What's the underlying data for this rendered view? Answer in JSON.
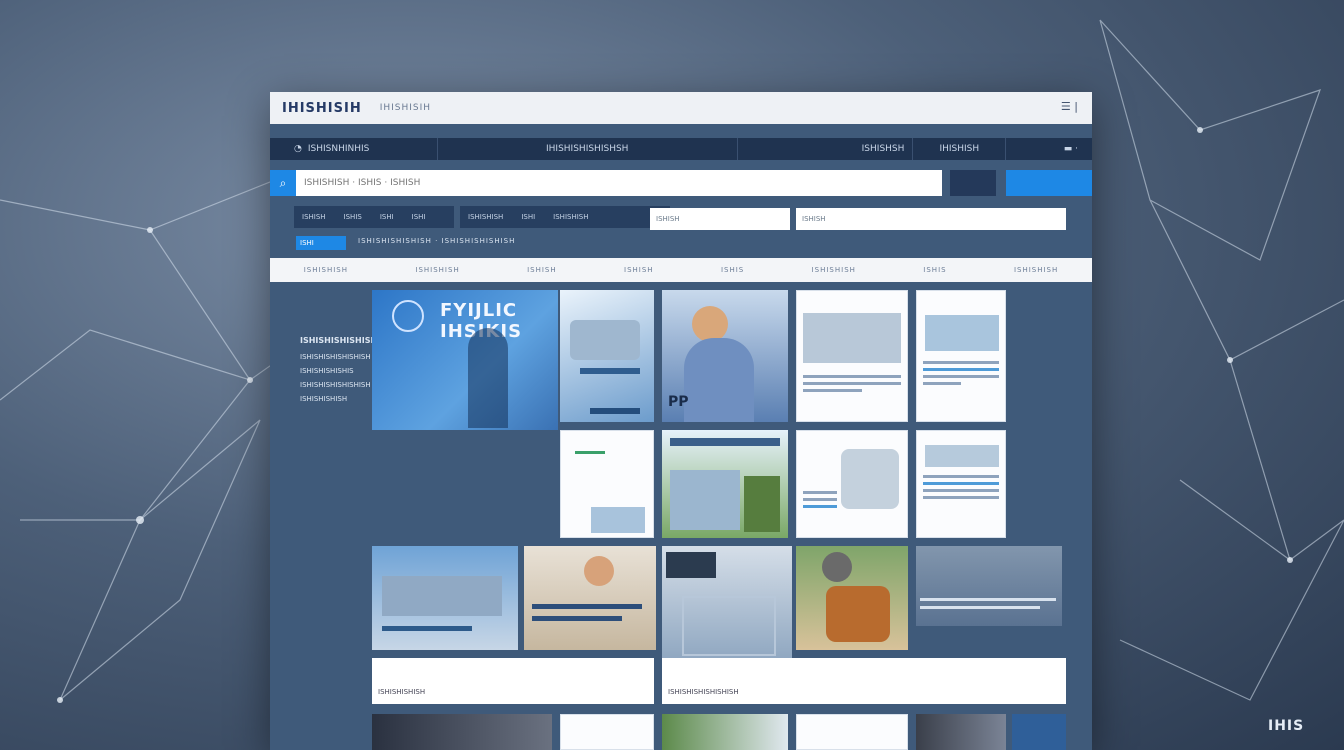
{
  "app": {
    "title": "IHISHISIH",
    "subtitle": "IHISHISIH",
    "menu_icon": "menu-icon"
  },
  "topnav": {
    "brand_icon": "logo-icon",
    "items": [
      "ISHISNHINHIS",
      "IHISHISHISHISHSH",
      "ISHISHSH",
      "IHISHISH"
    ],
    "account": "▬ ·"
  },
  "search": {
    "placeholder": "ISHISHISH · ISHIS · ISHISH",
    "icon": "search-icon",
    "button_label": ""
  },
  "filters": {
    "chips": [
      "ISHISH",
      "ISHIS",
      "ISHI",
      "ISHI",
      "ISHISHISH",
      "ISHI",
      "ISHISHISH"
    ],
    "field1": "ISHISH",
    "field2": "ISHISH"
  },
  "tag": "ISHI",
  "meta": "ISHISHISHISHISH · ISHISHISHISHISH",
  "tabs": [
    "ISHISHISH",
    "ISHISHISH",
    "ISHISH",
    "ISHISH",
    "ISHIS",
    "ISHISHISH",
    "ISHIS",
    "ISHISHISH"
  ],
  "sidebar": {
    "heading": "ISHISHISHISHISH",
    "lines": [
      "ISHISHISHISHISHISH",
      "ISHISHISHISHIS",
      "ISHISHISHISHISHISH",
      "ISHISHISHISH"
    ]
  },
  "banner": {
    "title": "FYIJLIC IHSIKIS"
  },
  "captions": [
    "ISHISHISHISH",
    "ISHISHISHISHISHISH"
  ],
  "corner": "IHIS"
}
